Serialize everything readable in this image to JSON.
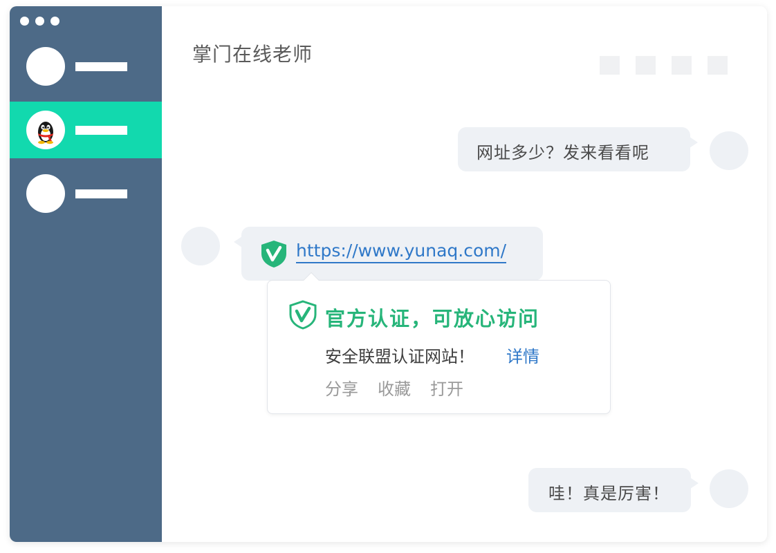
{
  "window": {
    "controls": [
      "close",
      "minimize",
      "maximize"
    ]
  },
  "sidebar": {
    "bg_color": "#4d6a87",
    "active_color": "#12d9ae",
    "contacts": [
      {
        "avatar": "blank-avatar",
        "active": false
      },
      {
        "avatar": "qq-penguin-icon",
        "active": true
      },
      {
        "avatar": "blank-avatar",
        "active": false
      }
    ]
  },
  "chat": {
    "title": "掌门在线老师",
    "toolbar_icons": [
      "toolbar-icon",
      "toolbar-icon",
      "toolbar-icon",
      "toolbar-icon"
    ],
    "messages": [
      {
        "side": "right",
        "text": "网址多少？发来看看呢"
      },
      {
        "side": "left",
        "link": "https://www.yunaq.com/",
        "icon": "verified-shield-icon"
      },
      {
        "side": "right",
        "text": "哇！真是厉害！"
      }
    ]
  },
  "verify_card": {
    "title": "官方认证，可放心访问",
    "desc": "安全联盟认证网站！",
    "detail_link": "详情",
    "actions": [
      "分享",
      "收藏",
      "打开"
    ],
    "brand_color": "#27b57a",
    "link_color": "#2f78c8"
  }
}
